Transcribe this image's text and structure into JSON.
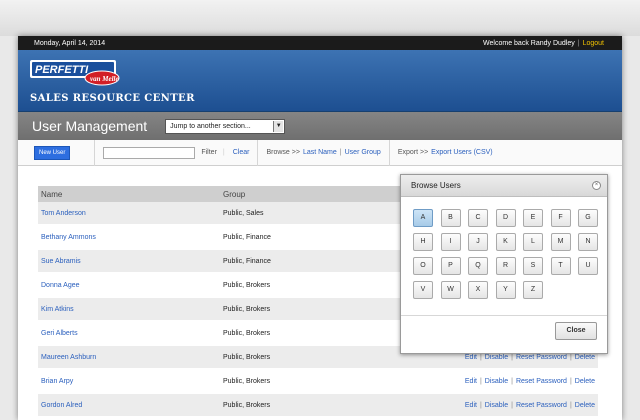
{
  "topbar": {
    "date": "Monday, April 14, 2014",
    "welcome": "Welcome back Randy Dudley",
    "separator": "|",
    "logout": "Logout"
  },
  "brand": {
    "logo_primary": "PERFETTI",
    "logo_secondary": "van Melle",
    "site_title": "SALES RESOURCE CENTER"
  },
  "titlebar": {
    "title": "User Management",
    "jump_select": "Jump to another section..."
  },
  "toolbar": {
    "new_user": "New User",
    "filter_value": "",
    "filter_label": "Filter",
    "clear": "Clear",
    "browse_label": "Browse >>",
    "browse_last_name": "Last Name",
    "browse_user_group": "User Group",
    "export_label": "Export >>",
    "export_users": "Export Users (CSV)"
  },
  "grid": {
    "headers": {
      "name": "Name",
      "group": "Group"
    },
    "rows": [
      {
        "name": "Tom Anderson",
        "group": "Public, Sales"
      },
      {
        "name": "Bethany Ammons",
        "group": "Public, Finance"
      },
      {
        "name": "Sue Abramis",
        "group": "Public, Finance"
      },
      {
        "name": "Donna Agee",
        "group": "Public, Brokers"
      },
      {
        "name": "Kim Atkins",
        "group": "Public, Brokers"
      },
      {
        "name": "Geri Alberts",
        "group": "Public, Brokers"
      },
      {
        "name": "Maureen Ashburn",
        "group": "Public, Brokers"
      },
      {
        "name": "Brian Arpy",
        "group": "Public, Brokers"
      },
      {
        "name": "Gordon Alred",
        "group": "Public, Brokers"
      }
    ],
    "actions": {
      "edit": "Edit",
      "disable": "Disable",
      "reset": "Reset Password",
      "delete": "Delete",
      "sep": "|"
    }
  },
  "browse_panel": {
    "title": "Browse Users",
    "letters": [
      "A",
      "B",
      "C",
      "D",
      "E",
      "F",
      "G",
      "H",
      "I",
      "J",
      "K",
      "L",
      "M",
      "N",
      "O",
      "P",
      "Q",
      "R",
      "S",
      "T",
      "U",
      "V",
      "W",
      "X",
      "Y",
      "Z"
    ],
    "selected": "A",
    "close": "Close"
  },
  "colors": {
    "brand_blue": "#1d4f91",
    "link_blue": "#2a5fbd",
    "logout_yellow": "#f2c200",
    "new_user_button": "#2d6ee0"
  }
}
